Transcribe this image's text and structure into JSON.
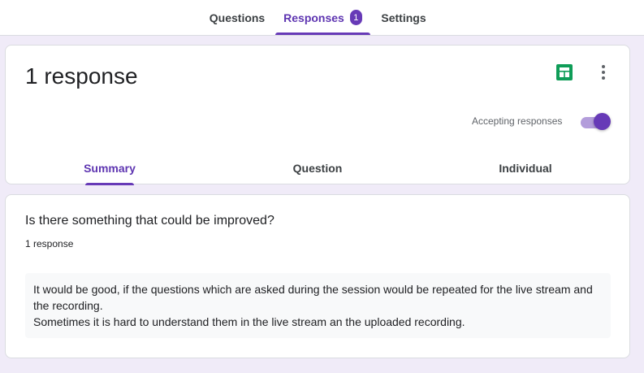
{
  "top_tabs": [
    {
      "label": "Questions",
      "active": false
    },
    {
      "label": "Responses",
      "active": true,
      "badge": "1"
    },
    {
      "label": "Settings",
      "active": false
    }
  ],
  "header_card": {
    "title": "1 response",
    "sheets_icon": "google-sheets-icon",
    "more_icon": "more-vert-icon",
    "accepting_label": "Accepting responses",
    "accepting": true
  },
  "sub_tabs": [
    {
      "label": "Summary",
      "active": true
    },
    {
      "label": "Question",
      "active": false
    },
    {
      "label": "Individual",
      "active": false
    }
  ],
  "question_card": {
    "title": "Is there something that could be improved?",
    "count": "1 response",
    "answer_lines": [
      "It would be good, if the questions which are asked during the session would be repeated for the live stream and the recording.",
      "Sometimes it is hard to understand them in the live stream an the uploaded recording."
    ]
  },
  "colors": {
    "accent": "#673ab7",
    "accent_light": "#b39ddb",
    "background": "#f0ebf8",
    "sheets_green": "#0f9d58"
  }
}
